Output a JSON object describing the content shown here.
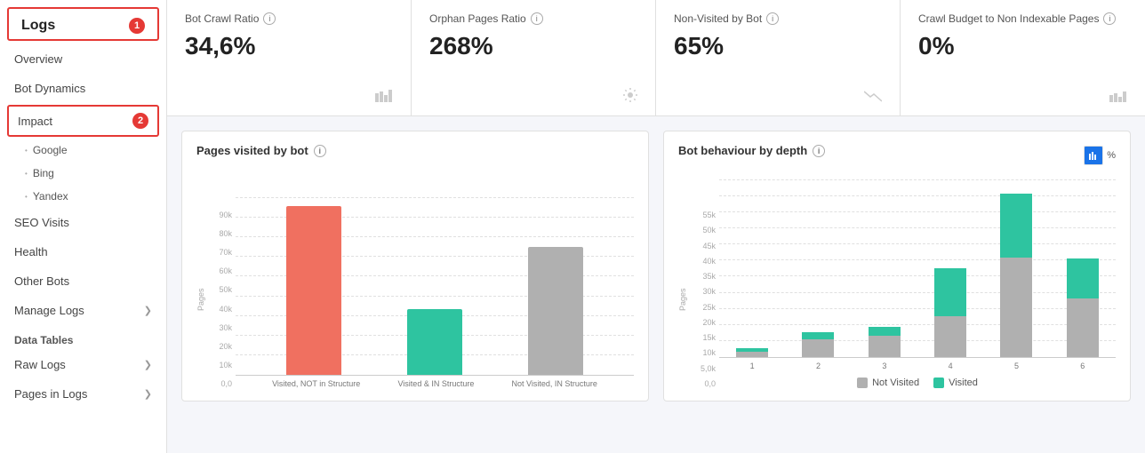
{
  "sidebar": {
    "logo": "Logs",
    "logo_badge": "1",
    "items": [
      {
        "id": "overview",
        "label": "Overview",
        "active": false
      },
      {
        "id": "bot-dynamics",
        "label": "Bot Dynamics",
        "active": false
      },
      {
        "id": "impact",
        "label": "Impact",
        "badge": "2"
      },
      {
        "id": "google",
        "label": "Google",
        "sub": true
      },
      {
        "id": "bing",
        "label": "Bing",
        "sub": true
      },
      {
        "id": "yandex",
        "label": "Yandex",
        "sub": true
      },
      {
        "id": "seo-visits",
        "label": "SEO Visits",
        "active": false
      },
      {
        "id": "health",
        "label": "Health",
        "active": false
      },
      {
        "id": "other-bots",
        "label": "Other Bots",
        "active": false
      },
      {
        "id": "manage-logs",
        "label": "Manage Logs",
        "arrow": true
      }
    ],
    "data_tables_label": "Data Tables",
    "data_items": [
      {
        "id": "raw-logs",
        "label": "Raw Logs",
        "arrow": true
      },
      {
        "id": "pages-in-logs",
        "label": "Pages in Logs",
        "arrow": true
      }
    ]
  },
  "metrics": [
    {
      "id": "bot-crawl-ratio",
      "title": "Bot Crawl Ratio",
      "value": "34,6%",
      "icon": "bar-chart"
    },
    {
      "id": "orphan-pages-ratio",
      "title": "Orphan Pages Ratio",
      "value": "268%",
      "icon": "settings"
    },
    {
      "id": "non-visited-by-bot",
      "title": "Non-Visited by Bot",
      "value": "65%",
      "icon": "trending-down"
    },
    {
      "id": "crawl-budget",
      "title": "Crawl Budget to Non Indexable Pages",
      "value": "0%",
      "icon": "bar-chart-2"
    }
  ],
  "pages_visited_chart": {
    "title": "Pages visited by bot",
    "y_label": "Pages",
    "y_axis": [
      "90k",
      "80k",
      "70k",
      "60k",
      "50k",
      "40k",
      "30k",
      "20k",
      "10k",
      "0,0"
    ],
    "bars": [
      {
        "label": "Visited, NOT in Structure",
        "color": "#f07060",
        "height_pct": 95
      },
      {
        "label": "Visited & IN Structure",
        "color": "#2ec4a0",
        "height_pct": 37
      },
      {
        "label": "Not Visited, IN Structure",
        "color": "#b0b0b0",
        "height_pct": 72
      }
    ]
  },
  "bot_behaviour_chart": {
    "title": "Bot behaviour by depth",
    "y_label": "Pages",
    "y_axis": [
      "55k",
      "50k",
      "45k",
      "40k",
      "35k",
      "30k",
      "25k",
      "20k",
      "15k",
      "10k",
      "5,0k",
      "0,0"
    ],
    "x_axis": [
      "1",
      "2",
      "3",
      "4",
      "5",
      "6"
    ],
    "stacks": [
      {
        "not_visited_pct": 5,
        "visited_pct": 2
      },
      {
        "not_visited_pct": 15,
        "visited_pct": 4
      },
      {
        "not_visited_pct": 16,
        "visited_pct": 5
      },
      {
        "not_visited_pct": 25,
        "visited_pct": 30
      },
      {
        "not_visited_pct": 62,
        "visited_pct": 40
      },
      {
        "not_visited_pct": 36,
        "visited_pct": 25
      }
    ],
    "legend": [
      {
        "label": "Not Visited",
        "color": "#b0b0b0"
      },
      {
        "label": "Visited",
        "color": "#2ec4a0"
      }
    ],
    "toggle_percent": "%"
  }
}
